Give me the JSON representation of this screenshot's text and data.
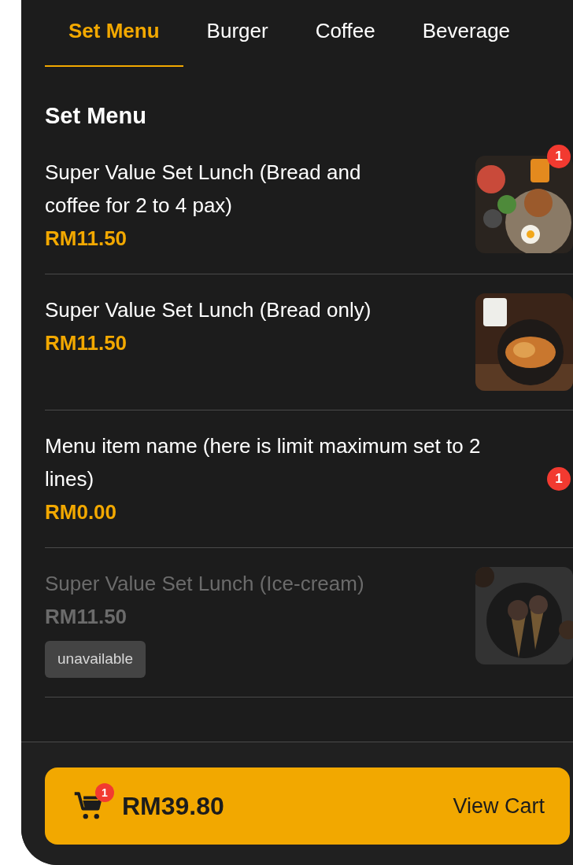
{
  "tabs": [
    {
      "label": "Set Menu",
      "selected": true
    },
    {
      "label": "Burger",
      "selected": false
    },
    {
      "label": "Coffee",
      "selected": false
    },
    {
      "label": "Beverage",
      "selected": false
    }
  ],
  "section_title": "Set Menu",
  "items": [
    {
      "name": "Super Value Set Lunch (Bread and coffee for 2 to 4 pax)",
      "price": "RM11.50",
      "badge": "1",
      "available": true
    },
    {
      "name": "Super Value Set Lunch (Bread only)",
      "price": "RM11.50",
      "available": true
    },
    {
      "name": "Menu item name (here is limit maximum set to 2 lines)",
      "price": "RM0.00",
      "badge": "1",
      "available": true
    },
    {
      "name": "Super Value Set Lunch (Ice-cream)",
      "price": "RM11.50",
      "available": false,
      "tag": "unavailable"
    }
  ],
  "cart": {
    "badge": "1",
    "total": "RM39.80",
    "action": "View Cart"
  }
}
